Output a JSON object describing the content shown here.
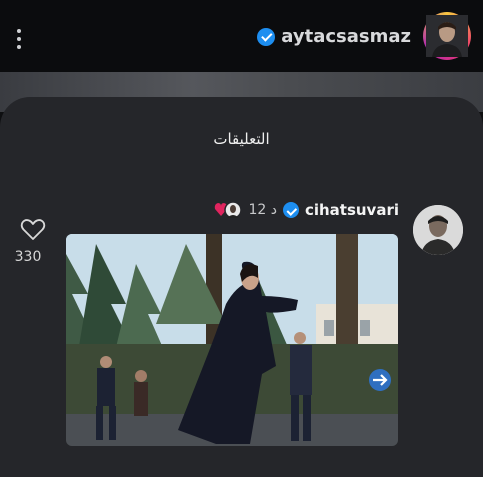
{
  "header": {
    "username": "aytacsasmaz",
    "menu_icon": "kebab-icon",
    "verified_icon": "verified-badge-icon"
  },
  "comments_sheet": {
    "title": "التعليقات"
  },
  "comment": {
    "username": "cihatsuvari",
    "time": "12 د",
    "likes": "330",
    "like_icon": "heart-outline-icon",
    "reaction_icons": [
      "heart-reaction-icon",
      "avatar-reaction-icon"
    ]
  },
  "colors": {
    "background": "#0e0f11",
    "sheet": "#25262a",
    "verified": "#1d8ef0"
  }
}
